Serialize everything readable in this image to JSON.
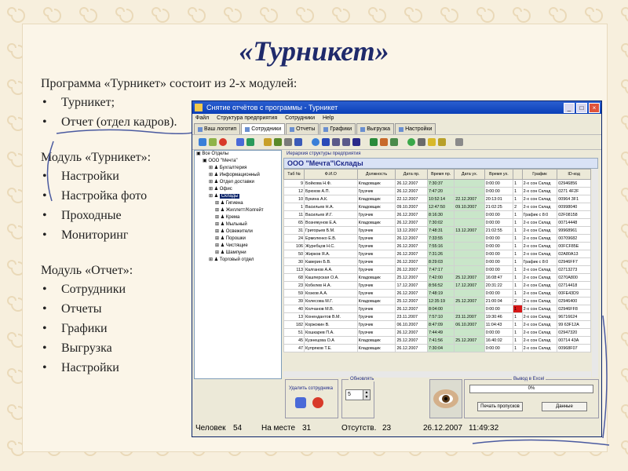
{
  "slide": {
    "title": "«Турникет»",
    "intro": "Программа «Турникет» состоит из 2-х модулей:",
    "modules": [
      "Турникет;",
      "Отчет (отдел кадров)."
    ],
    "module1_title": "Модуль «Турникет»:",
    "module1_items": [
      "Настройки",
      "Настройка фото",
      "Проходные",
      "Мониторинг"
    ],
    "module2_title": "Модуль «Отчет»:",
    "module2_items": [
      "Сотрудники",
      "Отчеты",
      "Графики",
      "Выгрузка",
      "Настройки"
    ]
  },
  "window": {
    "title": "Снятие отчётов с программы - Турникет",
    "menu": [
      "Файл",
      "Структура предприятия",
      "Сотрудники",
      "Help"
    ],
    "tabs": [
      "Ваш логотип",
      "Сотрудники",
      "Отчеты",
      "Графики",
      "Выгрузка",
      "Настройки"
    ],
    "tree": [
      {
        "label": "Все Отделы",
        "level": 0
      },
      {
        "label": "ООО \"Мечта\"",
        "level": 1
      },
      {
        "label": "Бухгалтерия",
        "level": 2
      },
      {
        "label": "Информационный",
        "level": 2
      },
      {
        "label": "Отдел доставки",
        "level": 2
      },
      {
        "label": "Офис",
        "level": 2
      },
      {
        "label": "Склады",
        "level": 2,
        "selected": true
      },
      {
        "label": "Гигиена",
        "level": 3
      },
      {
        "label": "Жиллетт/Колгейт",
        "level": 3
      },
      {
        "label": "Крема",
        "level": 3
      },
      {
        "label": "Мыльный",
        "level": 3
      },
      {
        "label": "Освежители",
        "level": 3
      },
      {
        "label": "Порошки",
        "level": 3
      },
      {
        "label": "Чистящие",
        "level": 3
      },
      {
        "label": "Шампуни",
        "level": 3
      },
      {
        "label": "Торговый отдел",
        "level": 2
      }
    ],
    "grid_caption": "Иерархия структуры предприятия",
    "grid_header": "ООО \"Мечта\"\\Склады",
    "columns": [
      "Таб №",
      "Ф.И.О",
      "Должность",
      "Дата пр.",
      "Время пр.",
      "Дата ух.",
      "Время ух.",
      "",
      "График",
      "ID-код"
    ],
    "rows": [
      [
        "9",
        "Бойкова Н.Ф.",
        "Кладовщик",
        "26.12.2007",
        "7:30:37",
        "",
        "0:00:00",
        "1",
        "2-х сон Склад",
        "02946856"
      ],
      [
        "12",
        "Брюхов А.П.",
        "Грузчик",
        "26.12.2007",
        "7:47:20",
        "",
        "0:00:00",
        "1",
        "2-х сон Склад",
        "0271 4F2F"
      ],
      [
        "10",
        "Букина А.К.",
        "Кладовщик",
        "22.12.2007",
        "10:52:14",
        "22.12.2007",
        "20:13:01",
        "1",
        "2-х сон Склад",
        "00964 3F1"
      ],
      [
        "1",
        "Васильев Н.А.",
        "Кладовщик",
        "09.10.2007",
        "12:47:50",
        "09.10.2007",
        "21:02:25",
        "2",
        "2-х сон Склад",
        "00998040"
      ],
      [
        "11",
        "Васильев И.Г.",
        "Грузчик",
        "26.12.2007",
        "8:16:30",
        "",
        "0:00:00",
        "1",
        "График с 8:0",
        "02F08158"
      ],
      [
        "65",
        "Вознякунов Е.А.",
        "Кладовщик",
        "26.12.2007",
        "7:30:02",
        "",
        "0:00:00",
        "1",
        "2-х сон Склад",
        "00714448"
      ],
      [
        "31",
        "Григорьев Б.М.",
        "Грузчик",
        "13.12.2007",
        "7:48:31",
        "13.12.2007",
        "21:02:55",
        "1",
        "2-х сон Склад",
        "99968961"
      ],
      [
        "24",
        "Ермоленко Е.В.",
        "Грузчик",
        "26.12.2007",
        "7:33:55",
        "",
        "0:00:00",
        "1",
        "2-х сон Склад",
        "00709682"
      ],
      [
        "106",
        "Журебцов Н.С.",
        "Грузчик",
        "26.12.2007",
        "7:55:16",
        "",
        "0:00:00",
        "1",
        "2-х сон Склад",
        "00FCF85E"
      ],
      [
        "50",
        "Жирков Я.А.",
        "Грузчик",
        "26.12.2007",
        "7:31:26",
        "",
        "0:00:00",
        "1",
        "2-х сон Склад",
        "02A80A13"
      ],
      [
        "30",
        "Каверин Б.В.",
        "Грузчик",
        "26.12.2007",
        "8:29:03",
        "",
        "0:00:00",
        "1",
        "График с 8:0",
        "02946FF7"
      ],
      [
        "113",
        "Калганов А.А.",
        "Грузчик",
        "26.12.2007",
        "7:47:17",
        "",
        "0:00:00",
        "1",
        "2-х сон Склад",
        "02713273"
      ],
      [
        "68",
        "Кашперская О.А.",
        "Кладовщик",
        "25.12.2007",
        "7:42:00",
        "25.12.2007",
        "16:08:47",
        "1",
        "2-х сон Склад",
        "0270A800"
      ],
      [
        "23",
        "Кобелев Н.А.",
        "Грузчик",
        "17.12.2007",
        "8:56:52",
        "17.12.2007",
        "20:31:22",
        "1",
        "2-х сон Склад",
        "02714418"
      ],
      [
        "59",
        "Козков А.А.",
        "Грузчик",
        "26.12.2007",
        "7:48:19",
        "",
        "0:00:00",
        "1",
        "2-х сон Склад",
        "00FE43D9"
      ],
      [
        "39",
        "Колесова М.Г.",
        "Кладовщик",
        "25.12.2007",
        "12:35:19",
        "25.12.2007",
        "21:00:04",
        "2",
        "2-х сон Склад",
        "02946400"
      ],
      [
        "40",
        "Колчанов М.В.",
        "Грузчик",
        "26.12.2007",
        "8:04:00",
        "",
        "0:00:00",
        "1",
        "2-х сон Склад",
        "02946FF8"
      ],
      [
        "13",
        "Конендантов В.М.",
        "Грузчик",
        "23.11.2007",
        "7:57:10",
        "23.11.2007",
        "19:30:46",
        "1",
        "2-х сон Склад",
        "96716624"
      ],
      [
        "182",
        "Коржокин В.",
        "Грузчик",
        "06.10.2007",
        "8:47:09",
        "06.10.2007",
        "11:04:43",
        "1",
        "2-х сон Склад",
        "99 63F12A"
      ],
      [
        "51",
        "Кошкарев П.А.",
        "Грузчик",
        "26.12.2007",
        "7:44:49",
        "",
        "0:00:00",
        "1",
        "2-х сон Склад",
        "02947320"
      ],
      [
        "45",
        "Кузнецова О.А",
        "Кладовщик",
        "25.12.2007",
        "7:41:56",
        "25.12.2007",
        "16:40:02",
        "1",
        "2-х сон Склад",
        "00714 43A"
      ],
      [
        "47",
        "Купряков Т.Е.",
        "Кладовщик",
        "26.12.2007",
        "7:30:04",
        "",
        "0:00:00",
        "1",
        "2-х сон Склад",
        "00968F07"
      ]
    ],
    "delete_label": "Удалить сотрудника",
    "refresh_label": "Обновлять",
    "refresh_value": "5",
    "excel_label": "Вывод в Excel",
    "progress_text": "0%",
    "print_button": "Печать пропусков",
    "data_button": "Данные",
    "status": {
      "people_label": "Человек",
      "people_value": "54",
      "present_label": "На месте",
      "present_value": "31",
      "absent_label": "Отсутств.",
      "absent_value": "23",
      "date": "26.12.2007",
      "time": "11:49:32"
    }
  },
  "colors": {
    "title": "#1f2a6b",
    "background": "#f7efdd",
    "accent_line": "#4a5aa0",
    "window_titlebar": "#0a3fb8",
    "highlight_red": "#d81818",
    "highlight_green": "#c9e6c9"
  }
}
